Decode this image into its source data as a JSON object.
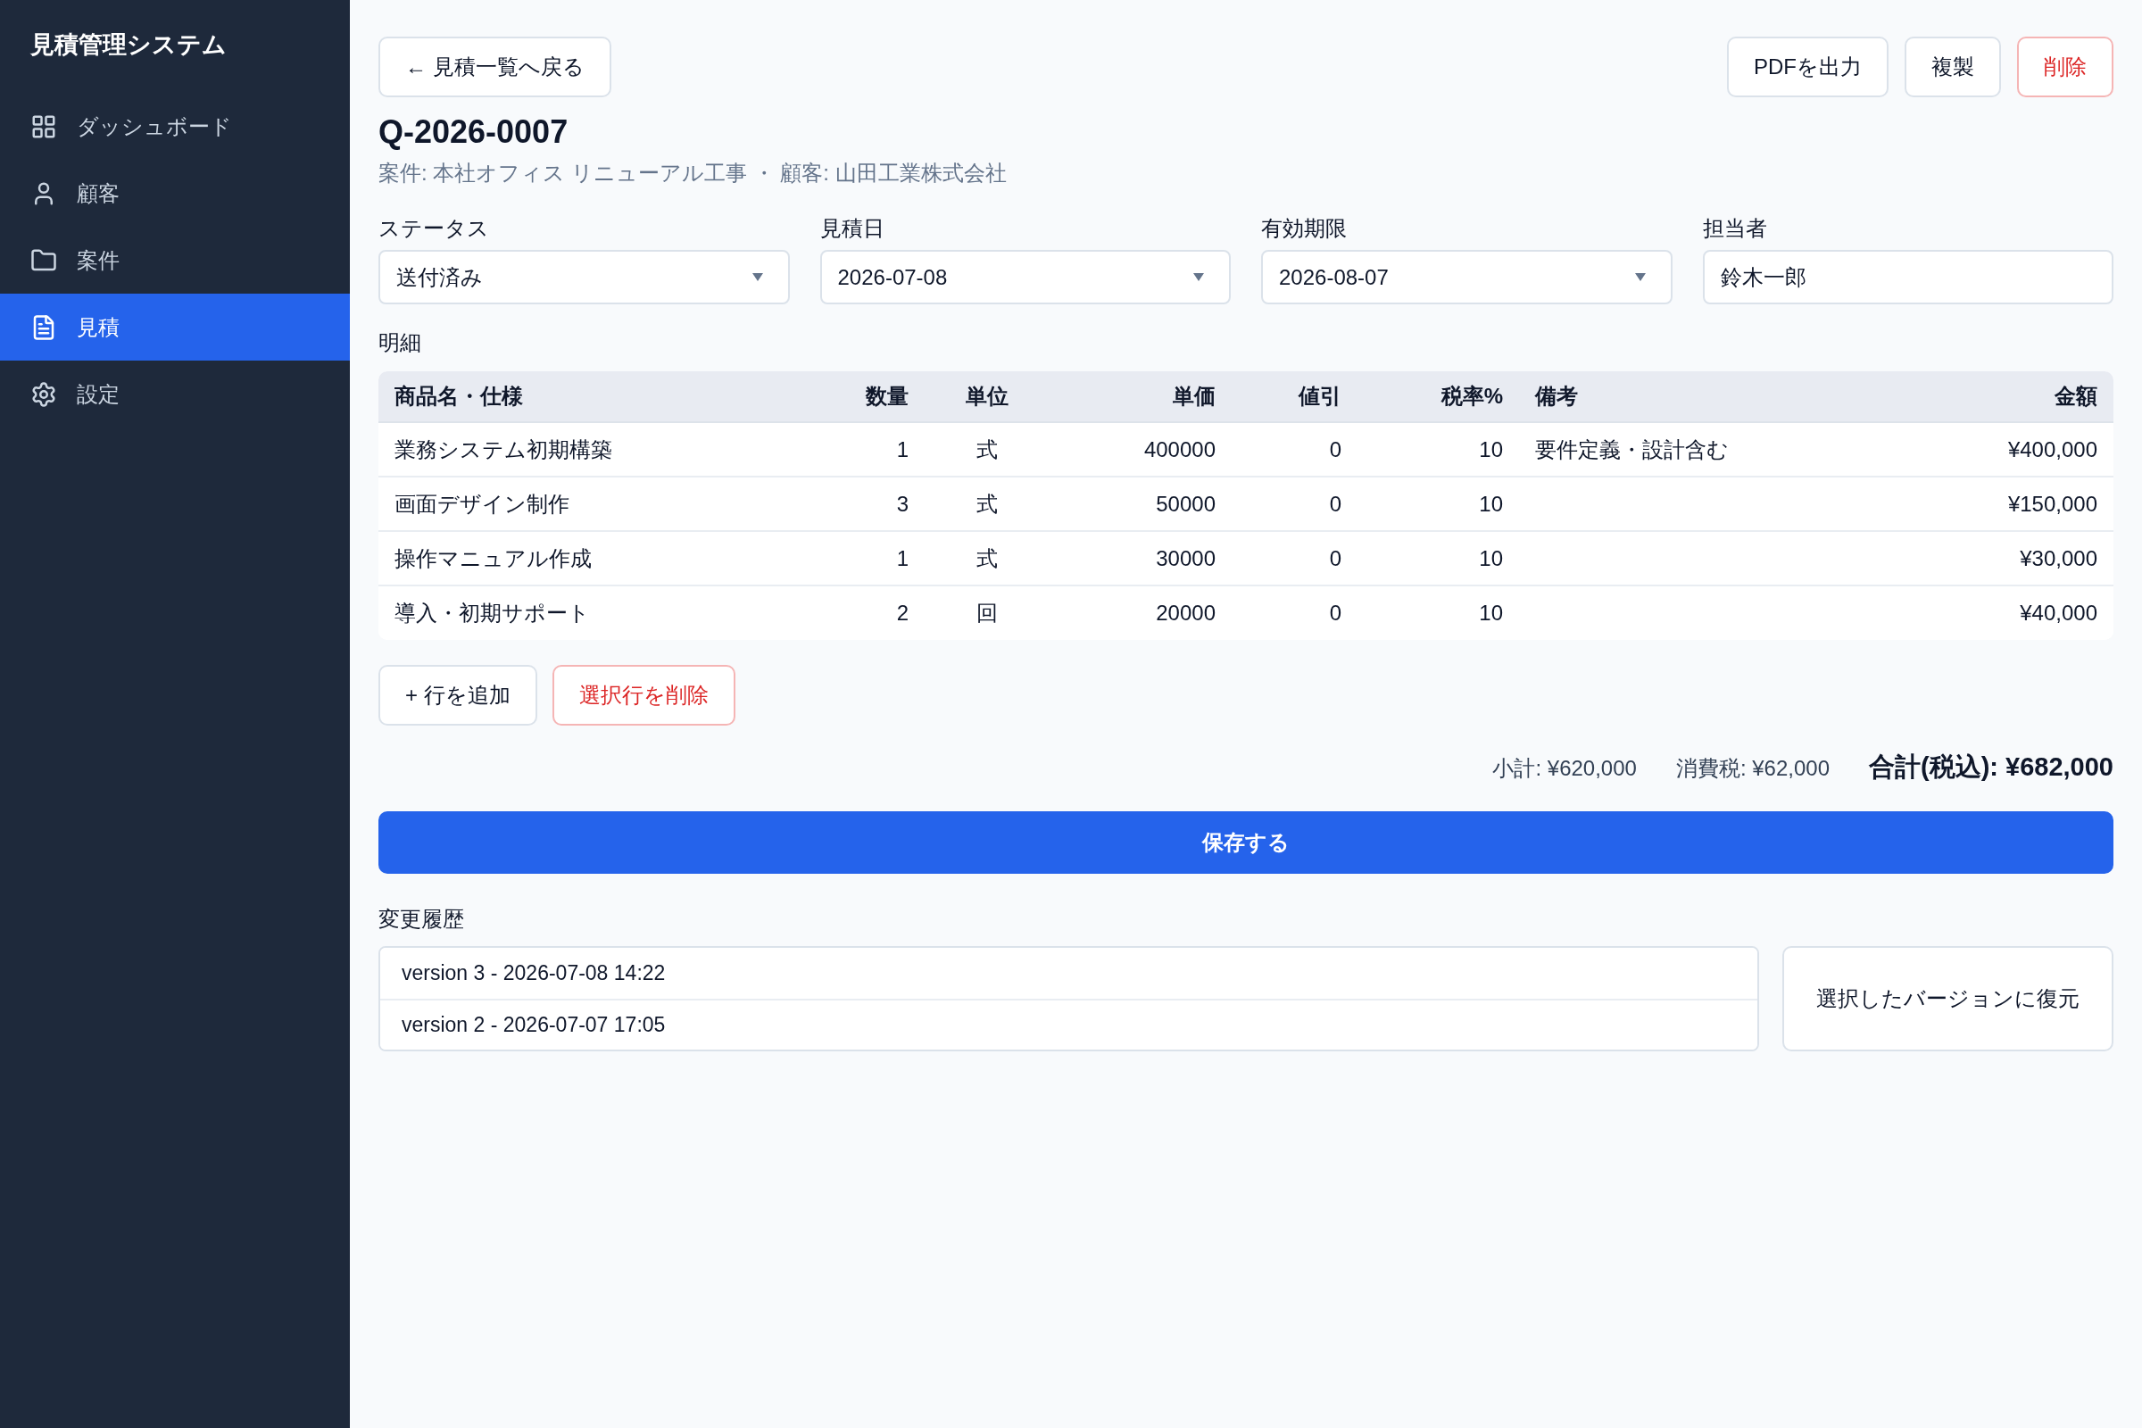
{
  "sidebar": {
    "title": "見積管理システム",
    "items": [
      {
        "label": "ダッシュボード",
        "selected": false
      },
      {
        "label": "顧客",
        "selected": false
      },
      {
        "label": "案件",
        "selected": false
      },
      {
        "label": "見積",
        "selected": true
      },
      {
        "label": "設定",
        "selected": false
      }
    ]
  },
  "header": {
    "back_button": "← 見積一覧へ戻る",
    "actions": [
      {
        "label": "PDFを出力",
        "kind": "default"
      },
      {
        "label": "複製",
        "kind": "default"
      },
      {
        "label": "削除",
        "kind": "danger"
      }
    ]
  },
  "quote": {
    "number": "Q-2026-0007",
    "subtitle": "案件: 本社オフィス リニューアル工事 ・ 顧客: 山田工業株式会社"
  },
  "fields": [
    {
      "label": "ステータス",
      "kind": "select",
      "value": "送付済み"
    },
    {
      "label": "見積日",
      "kind": "select",
      "value": "2026-07-08"
    },
    {
      "label": "有効期限",
      "kind": "select",
      "value": "2026-08-07"
    },
    {
      "label": "担当者",
      "kind": "text",
      "value": "鈴木一郎"
    }
  ],
  "line_items": {
    "title": "明細",
    "columns": [
      "商品名・仕様",
      "数量",
      "単位",
      "単価",
      "値引",
      "税率%",
      "備考",
      "金額"
    ],
    "rows": [
      {
        "item": "業務システム初期構築",
        "quantity": "1",
        "unit": "式",
        "unit_price": "400000",
        "discount": "0",
        "tax_rate": "10",
        "note": "要件定義・設計含む",
        "amount": "¥400,000"
      },
      {
        "item": "画面デザイン制作",
        "quantity": "3",
        "unit": "式",
        "unit_price": "50000",
        "discount": "0",
        "tax_rate": "10",
        "amount": "¥150,000"
      },
      {
        "item": "操作マニュアル作成",
        "quantity": "1",
        "unit": "式",
        "unit_price": "30000",
        "discount": "0",
        "tax_rate": "10",
        "amount": "¥30,000"
      },
      {
        "item": "導入・初期サポート",
        "quantity": "2",
        "unit": "回",
        "unit_price": "20000",
        "discount": "0",
        "tax_rate": "10",
        "amount": "¥40,000"
      }
    ],
    "add_button": "+ 行を追加",
    "delete_button": "選択行を削除"
  },
  "totals": {
    "subtotal": "小計: ¥620,000",
    "tax": "消費税: ¥62,000",
    "total": "合計(税込): ¥682,000"
  },
  "save_button": "保存する",
  "history": {
    "title": "変更履歴",
    "versions": [
      {
        "label": "version 3 - 2026-07-08 14:22",
        "selected": false
      },
      {
        "label": "version 2 - 2026-07-07 17:05",
        "selected": false
      }
    ],
    "restore_button": "選択したバージョンに復元"
  }
}
